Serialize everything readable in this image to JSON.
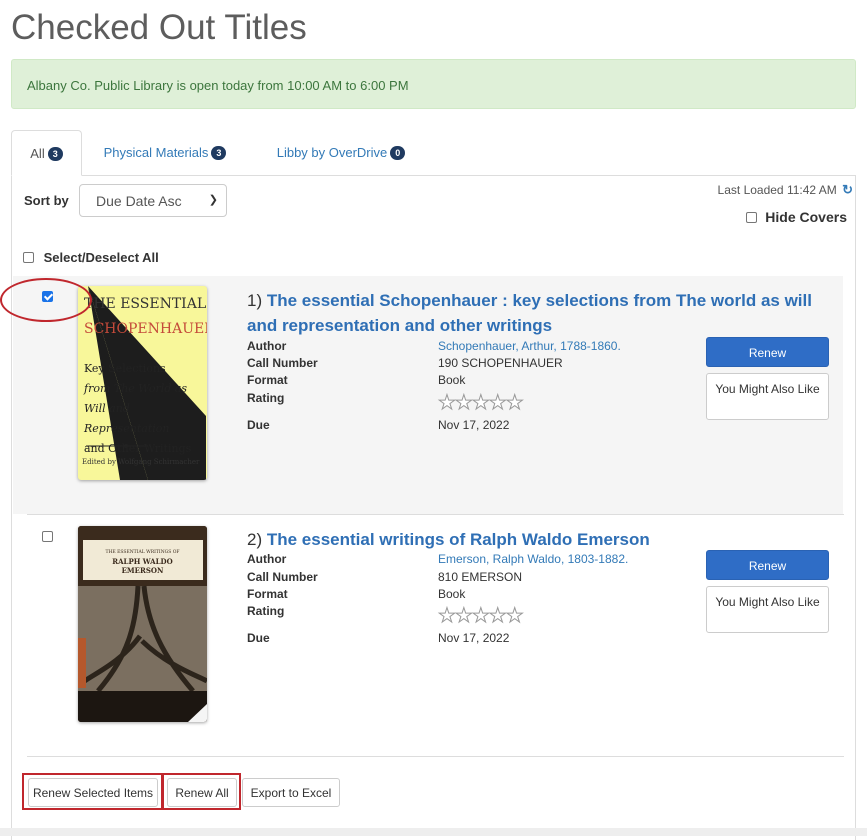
{
  "page": {
    "title": "Checked Out Titles"
  },
  "alert": {
    "text": "Albany Co. Public Library is open today from 10:00 AM to 6:00 PM"
  },
  "tabs": [
    {
      "label": "All",
      "count": "3"
    },
    {
      "label": "Physical Materials",
      "count": "3"
    },
    {
      "label": "Libby by OverDrive",
      "count": "0"
    }
  ],
  "toolbar": {
    "sort_label": "Sort by",
    "sort_value": "Due Date Asc",
    "last_loaded": "Last Loaded 11:42 AM",
    "hide_covers": "Hide Covers",
    "select_all": "Select/Deselect All"
  },
  "labels": {
    "author": "Author",
    "call_number": "Call Number",
    "format": "Format",
    "rating": "Rating",
    "due": "Due",
    "renew": "Renew",
    "you_might_also_like": "You Might Also Like"
  },
  "items": [
    {
      "number": "1)",
      "title": "The essential Schopenhauer : key selections from The world as will and representation and other writings",
      "author": "Schopenhauer, Arthur, 1788-1860.",
      "call_number": "190 SCHOPENHAUER",
      "format": "Book",
      "due": "Nov 17, 2022",
      "checked": true,
      "cover": {
        "line1": "THE ESSENTIAL",
        "line2": "SCHOPENHAUER",
        "sub1": "Key Selections",
        "sub2": "from The World as",
        "sub3": "Will and Representation",
        "sub4": "and Other Writings",
        "editor": "Edited by Wolfgang Schirmacher"
      }
    },
    {
      "number": "2)",
      "title": "The essential writings of Ralph Waldo Emerson",
      "author": "Emerson, Ralph Waldo, 1803-1882.",
      "call_number": "810 EMERSON",
      "format": "Book",
      "due": "Nov 17, 2022",
      "checked": false,
      "cover": {
        "line1": "THE ESSENTIAL WRITINGS OF",
        "line2": "RALPH WALDO",
        "line3": "EMERSON"
      }
    }
  ],
  "footer": {
    "renew_selected": "Renew Selected Items",
    "renew_all": "Renew All",
    "export": "Export to Excel"
  },
  "colors": {
    "link": "#337ab7",
    "primary_button": "#2f6dc6",
    "annotation": "#c0272d",
    "alert_bg": "#dff0d8"
  }
}
